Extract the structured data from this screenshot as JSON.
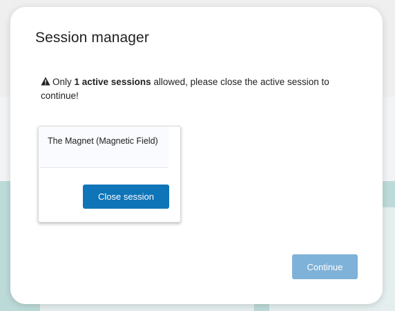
{
  "modal": {
    "title": "Session manager",
    "notice": {
      "prefix": "Only ",
      "highlight": "1 active sessions",
      "suffix": " allowed, please close the active session to continue!"
    },
    "sessions": [
      {
        "name": "The Magnet (Magnetic Field)",
        "close_label": "Close session"
      }
    ],
    "continue_label": "Continue",
    "continue_enabled": false
  },
  "colors": {
    "primary": "#0f74b8",
    "primary_disabled": "#7fb2d8",
    "warning_icon": "#212121",
    "backdrop_teal": "#bcdad8"
  },
  "icons": {
    "notice": "warning-triangle-icon"
  }
}
